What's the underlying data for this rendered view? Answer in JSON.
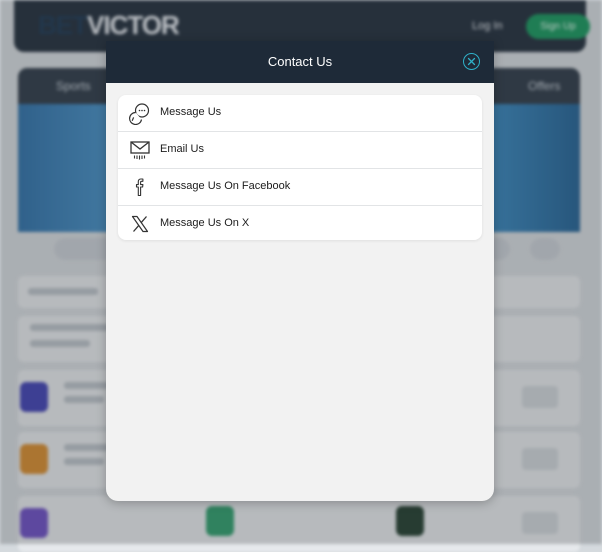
{
  "background": {
    "logo_bet": "BET",
    "logo_victor": "VICTOR",
    "login_label": "Log In",
    "signup_label": "Sign Up",
    "nav_sports": "Sports",
    "nav_offers": "Offers"
  },
  "modal": {
    "title": "Contact Us",
    "close_icon": "close-circle-icon",
    "items": [
      {
        "label": "Message Us",
        "icon": "chat-bubbles-icon"
      },
      {
        "label": "Email Us",
        "icon": "envelope-icon"
      },
      {
        "label": "Message Us On Facebook",
        "icon": "facebook-icon"
      },
      {
        "label": "Message Us On X",
        "icon": "x-logo-icon"
      }
    ]
  },
  "colors": {
    "header_bg": "#1e2a38",
    "close_accent": "#2fb0c8",
    "signup_green": "#14955a"
  }
}
